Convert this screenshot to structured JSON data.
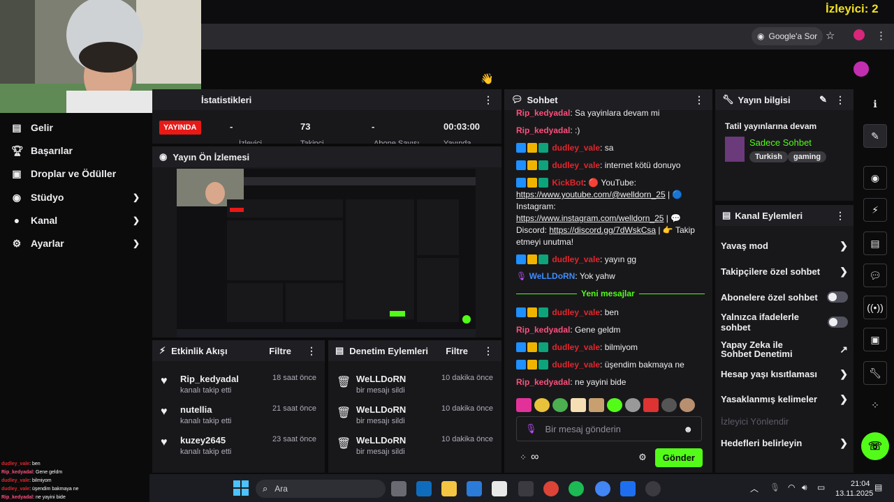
{
  "overlay": {
    "viewers": "İzleyici: 2"
  },
  "browser": {
    "google_sor": "Google'a Sor"
  },
  "sidebar": {
    "items": [
      {
        "label": "Gelir"
      },
      {
        "label": "Başarılar"
      },
      {
        "label": "Droplar ve Ödüller"
      },
      {
        "label": "Stüdyo"
      },
      {
        "label": "Kanal"
      },
      {
        "label": "Ayarlar"
      }
    ]
  },
  "stats": {
    "title": "İstatistikleri",
    "live_label": "YAYINDA",
    "viewers": "-",
    "followers": "73",
    "subs": "-",
    "uptime": "00:03:00",
    "sub_labels": [
      "İzleyici",
      "Takipçi",
      "Abone Sayısı",
      "Yayında"
    ]
  },
  "preview": {
    "title": "Yayın Ön İzlemesi"
  },
  "activity": {
    "title": "Etkinlik Akışı",
    "filter": "Filtre",
    "items": [
      {
        "name": "Rip_kedyadal",
        "sub": "kanalı takip etti",
        "time": "18 saat önce"
      },
      {
        "name": "nutellia",
        "sub": "kanalı takip etti",
        "time": "21 saat önce"
      },
      {
        "name": "kuzey2645",
        "sub": "kanalı takip etti",
        "time": "23 saat önce"
      }
    ]
  },
  "moderation": {
    "title": "Denetim Eylemleri",
    "filter": "Filtre",
    "items": [
      {
        "name": "WeLLDoRN",
        "sub": "bir mesajı sildi",
        "time": "10 dakika önce"
      },
      {
        "name": "WeLLDoRN",
        "sub": "bir mesajı sildi",
        "time": "10 dakika önce"
      },
      {
        "name": "WeLLDoRN",
        "sub": "bir mesajı sildi",
        "time": "10 dakika önce"
      }
    ]
  },
  "chat": {
    "title": "Sohbet",
    "messages": [
      {
        "user": "Rip_kedyadal",
        "text": "Sa yayinlara devam mi"
      },
      {
        "user": "Rip_kedyadal",
        "text": ":)"
      },
      {
        "user": "dudley_vale",
        "text": "sa"
      },
      {
        "user": "dudley_vale",
        "text": "internet kötü donuyo"
      },
      {
        "user": "KickBot",
        "text_1": "🔴 YouTube:",
        "link_yt": "https://www.youtube.com/@welldorn_25",
        "text_2": "Instagram:",
        "link_ig": "https://www.instagram.com/welldorn_25",
        "text_3": "Discord:",
        "link_dc": "https://discord.gg/7dWskCsa",
        "text_4": "👉 Takip etmeyi unutma!"
      },
      {
        "user": "dudley_vale",
        "text": "yayın gg"
      },
      {
        "user": "WeLLDoRN",
        "text": "Yok yahw"
      },
      {
        "user": "dudley_vale",
        "text": "ben"
      },
      {
        "user": "Rip_kedyadal",
        "text": "Gene geldm"
      },
      {
        "user": "dudley_vale",
        "text": "bilmiyom"
      },
      {
        "user": "dudley_vale",
        "text": "üşendim bakmaya ne"
      },
      {
        "user": "Rip_kedyadal",
        "text": "ne yayini bide"
      }
    ],
    "new_messages": "Yeni mesajlar",
    "input_placeholder": "Bir mesaj gönderin",
    "send": "Gönder",
    "infinity": "∞"
  },
  "stream_info": {
    "title": "Yayın bilgisi",
    "stream_title": "Tatil yayınlarına devam",
    "category": "Sadece Sohbet",
    "tags": [
      "Turkish",
      "gaming"
    ]
  },
  "channel_actions": {
    "title": "Kanal Eylemleri",
    "items": [
      {
        "label": "Yavaş mod",
        "kind": "arrow"
      },
      {
        "label": "Takipçilere özel sohbet",
        "kind": "arrow"
      },
      {
        "label": "Abonelere özel sohbet",
        "kind": "toggle"
      },
      {
        "label": "Yalnızca ifadelerle sohbet",
        "kind": "toggle"
      },
      {
        "label": "Yapay Zeka ile Sohbet Denetimi",
        "kind": "external"
      },
      {
        "label": "Hesap yaşı kısıtlaması",
        "kind": "arrow"
      },
      {
        "label": "Yasaklanmış kelimeler",
        "kind": "arrow"
      },
      {
        "label": "İzleyici Yönlendir",
        "kind": "disabled"
      },
      {
        "label": "Hedefleri belirleyin",
        "kind": "arrow"
      }
    ]
  },
  "overlay_chat": [
    {
      "user": "dudley_vale",
      "text": ": ben"
    },
    {
      "user": "Rip_kedyadal",
      "text": ": Gene geldm"
    },
    {
      "user": "dudley_vale",
      "text": ": bilmiyom"
    },
    {
      "user": "dudley_vale",
      "text": ": üşendim bakmaya ne"
    },
    {
      "user": "Rip_kedyadal",
      "text": ": ne yayini bide"
    }
  ],
  "taskbar": {
    "search": "Ara",
    "time": "21:04",
    "date": "13.11.2025"
  },
  "colors": {
    "kick_green": "#53fc18",
    "live_red": "#e91916",
    "panel": "#18181b"
  }
}
